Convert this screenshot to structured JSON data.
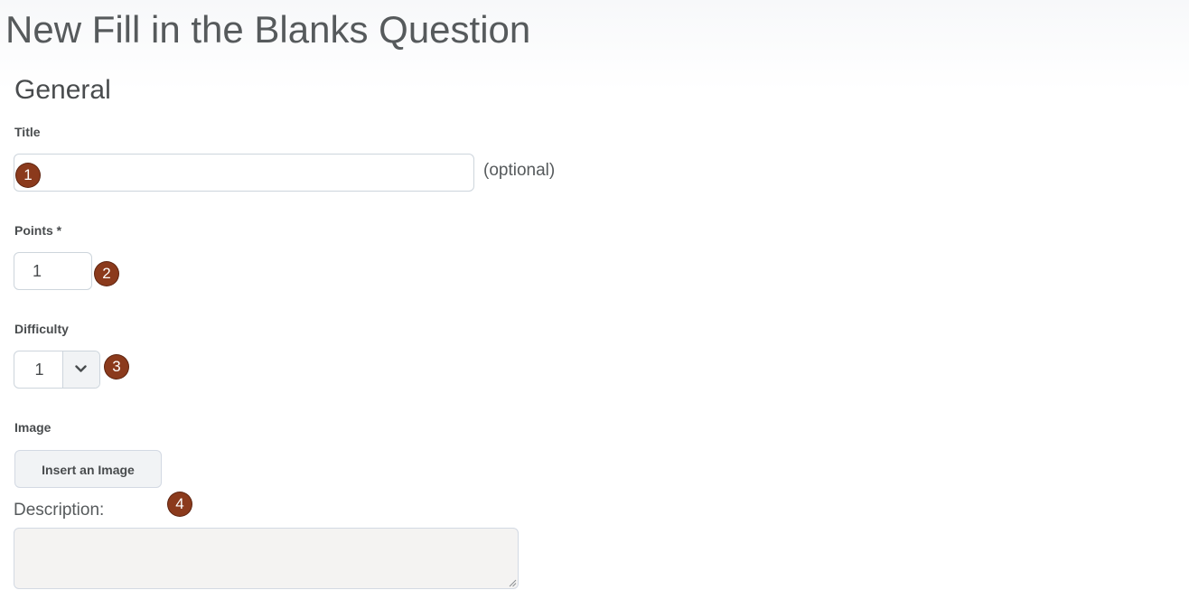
{
  "page": {
    "title": "New Fill in the Blanks Question"
  },
  "general": {
    "heading": "General",
    "title_field": {
      "label": "Title",
      "value": "",
      "hint": "(optional)"
    },
    "points_field": {
      "label": "Points *",
      "value": "1"
    },
    "difficulty_field": {
      "label": "Difficulty",
      "value": "1"
    },
    "image_field": {
      "label": "Image",
      "button_label": "Insert an Image"
    },
    "description_field": {
      "label": "Description:",
      "value": ""
    }
  },
  "annotations": {
    "markers": [
      "1",
      "2",
      "3",
      "4"
    ],
    "marker_color": "#8b3a1c"
  },
  "icons": {
    "difficulty_toggle": "chevron-down-icon",
    "description_resize": "resize-grip-icon"
  }
}
